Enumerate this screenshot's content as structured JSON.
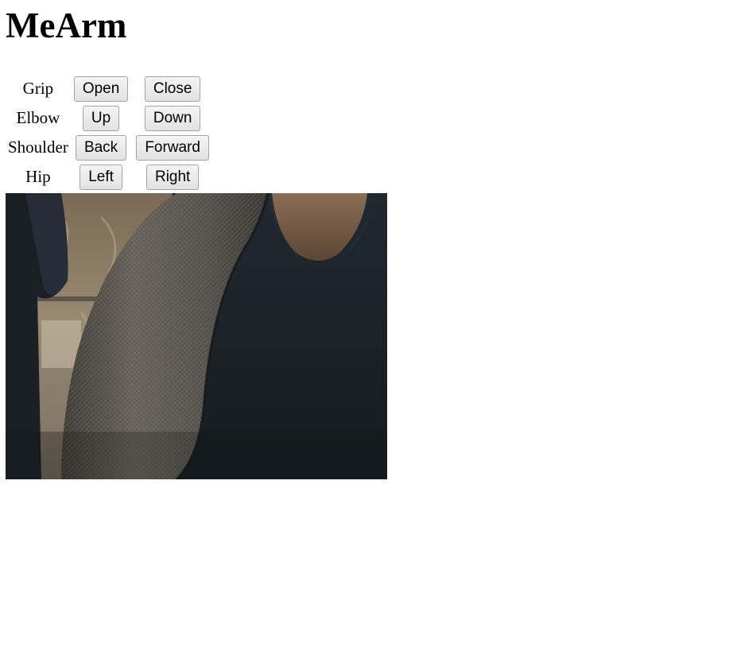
{
  "page": {
    "title": "MeArm"
  },
  "controls": [
    {
      "label": "Grip",
      "buttons": [
        "Open",
        "Close"
      ]
    },
    {
      "label": "Elbow",
      "buttons": [
        "Up",
        "Down"
      ]
    },
    {
      "label": "Shoulder",
      "buttons": [
        "Back",
        "Forward"
      ]
    },
    {
      "label": "Hip",
      "buttons": [
        "Left",
        "Right"
      ]
    }
  ],
  "camera": {
    "icon": "webcam-feed-image"
  }
}
